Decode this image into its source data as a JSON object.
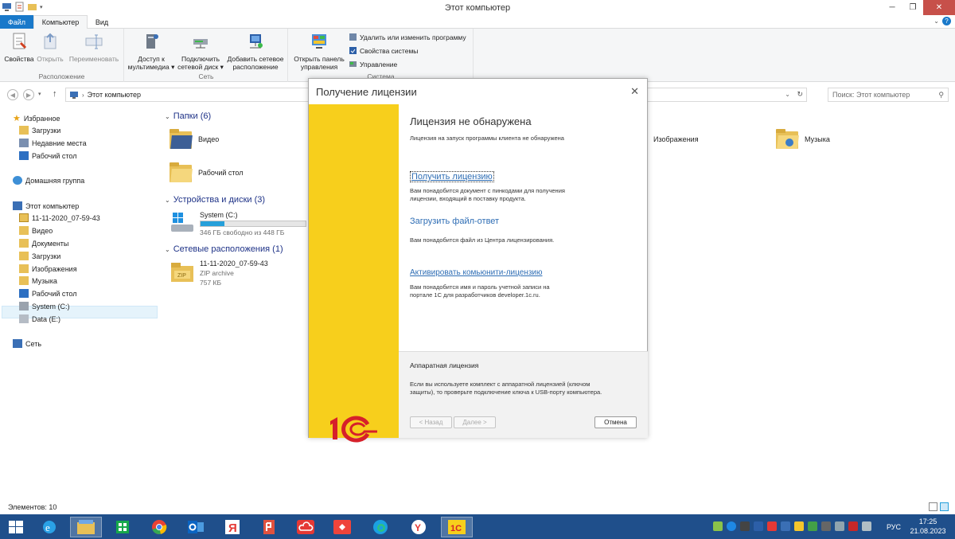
{
  "window": {
    "title": "Этот компьютер"
  },
  "ribbon": {
    "tabs": [
      "Файл",
      "Компьютер",
      "Вид"
    ],
    "location_group": {
      "label": "Расположение",
      "buttons": [
        "Свойства",
        "Открыть",
        "Переименовать"
      ]
    },
    "network_group": {
      "label": "Сеть",
      "media_access": [
        "Доступ к",
        "мультимедиа"
      ],
      "map_drive": [
        "Подключить",
        "сетевой диск"
      ],
      "add_location": [
        "Добавить сетевое",
        "расположение"
      ]
    },
    "system_group": {
      "label": "Система",
      "open_panel": [
        "Открыть панель",
        "управления"
      ],
      "uninstall": "Удалить или изменить программу",
      "system_props": "Свойства системы",
      "manage": "Управление"
    }
  },
  "address": {
    "path": "Этот компьютер",
    "search_placeholder": "Поиск: Этот компьютер"
  },
  "nav": {
    "favorites": "Избранное",
    "fav_items": [
      "Загрузки",
      "Недавние места",
      "Рабочий стол"
    ],
    "homegroup": "Домашняя группа",
    "this_pc": "Этот компьютер",
    "pc_items": [
      "11-11-2020_07-59-43",
      "Видео",
      "Документы",
      "Загрузки",
      "Изображения",
      "Музыка",
      "Рабочий стол",
      "System (C:)",
      "Data (E:)"
    ],
    "network": "Сеть"
  },
  "content": {
    "folders_header": "Папки (6)",
    "folders": [
      "Видео",
      "Рабочий стол",
      "Изображения",
      "Музыка"
    ],
    "devices_header": "Устройства и диски (3)",
    "drive": {
      "name": "System (C:)",
      "free": "346 ГБ свободно из 448 ГБ",
      "used_fraction": 0.228
    },
    "net_header": "Сетевые расположения (1)",
    "net_item": {
      "name": "11-11-2020_07-59-43",
      "type": "ZIP archive",
      "size": "757 КБ"
    }
  },
  "status": {
    "items": "Элементов: 10"
  },
  "dialog": {
    "title": "Получение лицензии",
    "heading": "Лицензия не обнаружена",
    "subtitle": "Лицензия на запуск программы клиента не обнаружена",
    "get_license": "Получить лицензию",
    "get_license_desc": [
      "Вам понадобится документ с пинкодами для получения",
      "лицензии, входящий в поставку продукта."
    ],
    "load_file": "Загрузить файл-ответ",
    "load_file_desc": "Вам понадобится файл из Центра лицензирования.",
    "community": "Активировать комьюнити-лицензию",
    "community_desc": [
      "Вам понадобится имя и пароль учетной записи на",
      "портале 1С для разработчиков developer.1c.ru."
    ],
    "hw_title": "Аппаратная лицензия",
    "hw_desc": [
      "Если вы используете комплект с аппаратной лицензией (ключом",
      "защиты), то проверьте подключение ключа к USB-порту компьютера."
    ],
    "back": "< Назад",
    "next": "Далее >",
    "cancel": "Отмена"
  },
  "taskbar": {
    "lang": "РУС",
    "time": "17:25",
    "date": "21.08.2023"
  },
  "colors": {
    "accent_blue": "#1979ca",
    "taskbar": "#1f4f8b",
    "onec_yellow": "#f7cf1c",
    "onec_red": "#d6202a",
    "link": "#2f6eb5"
  }
}
